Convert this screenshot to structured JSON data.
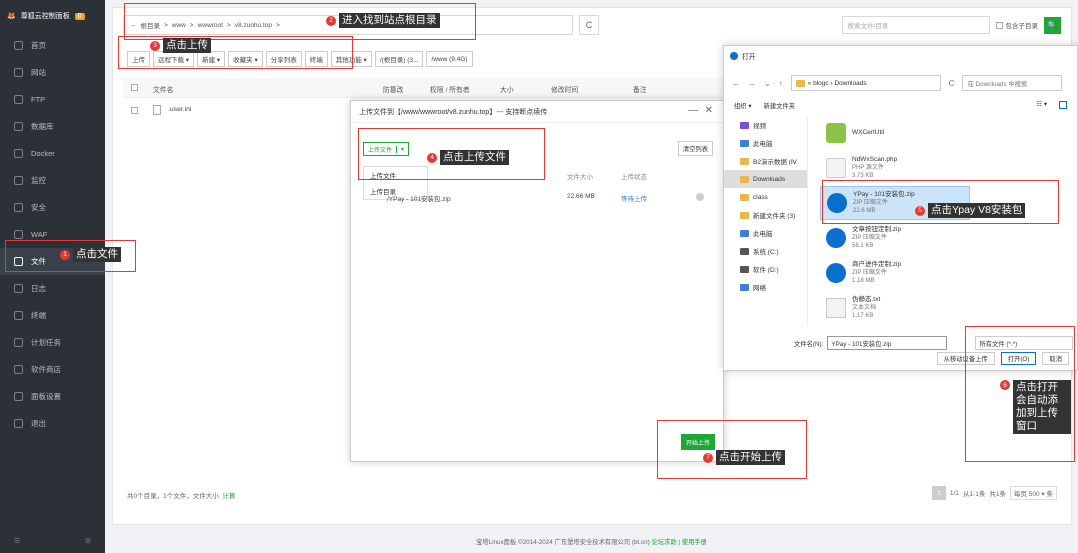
{
  "sidebar": {
    "brand": "尊狐云控制面板",
    "badge": "0",
    "items": [
      "首页",
      "网站",
      "FTP",
      "数据库",
      "Docker",
      "监控",
      "安全",
      "WAF",
      "文件",
      "日志",
      "终端",
      "计划任务",
      "软件商店",
      "面板设置",
      "退出"
    ],
    "foot_left": "☰",
    "foot_right": "⚙"
  },
  "path": {
    "back": "←",
    "parts": [
      "根目录",
      "www",
      "wwwroot",
      "v8.zunhu.top"
    ],
    "sep": ">"
  },
  "search": {
    "placeholder": "搜索文件/目录",
    "subdirs": "包含子目录",
    "btn": "🔍"
  },
  "toolbar": [
    "上传",
    "远程下载 ▾",
    "新建 ▾",
    "收藏夹 ▾",
    "分享列表",
    "终端",
    "其他功能 ▾",
    "/(根目录) (3...",
    "/www (9.4G)"
  ],
  "table": {
    "headers": [
      "文件名",
      "防篡改",
      "权限 / 所有者",
      "大小",
      "修改时间",
      "备注"
    ],
    "row": ".user.ini"
  },
  "footer": {
    "stats": "共0个目录，1个文件，文件大小:",
    "calc": "计算",
    "pager": [
      "1",
      "1/1",
      "从1-1条",
      "共1条",
      "每页 500 ▾ 条"
    ]
  },
  "copyright": {
    "text": "宝塔Linux面板 ©2014-2024 广东堡塔安全技术有限公司 (bt.cn)",
    "forum": "论坛求助",
    "sep": "|",
    "manual": "使用手册"
  },
  "upload": {
    "title": "上传文件到【/www/wwwroot/v8.zunhu.top】--- 支持断点续传",
    "min": "—",
    "close": "✕",
    "btn": "上传文件",
    "caret": "▾",
    "dd": [
      "上传文件",
      "上传目录"
    ],
    "clear": "清空列表",
    "cols": [
      "文件大小",
      "上传状态"
    ],
    "file": "/YPay - 101安装包.zip",
    "size": "22.66 MB",
    "status": "等待上传",
    "start": "开始上传"
  },
  "dialog": {
    "title": "打开",
    "address": "« blogc › Downloads",
    "search": "在 Downloads 中搜索",
    "cmds": [
      "组织 ▾",
      "新建文件夹"
    ],
    "nav": [
      {
        "n": "视频",
        "c": "#7b4fd6"
      },
      {
        "n": "此电脑",
        "c": "#3b7fd6"
      },
      {
        "n": "B2演示数据 (Ⅳ",
        "c": "#e8b84a"
      },
      {
        "n": "Downloads",
        "c": "#e8b84a"
      },
      {
        "n": "class",
        "c": "#e8b84a"
      },
      {
        "n": "新建文件夹 (3)",
        "c": "#e8b84a"
      },
      {
        "n": "此电脑",
        "c": "#3b7fd6"
      },
      {
        "n": "系统 (C:)",
        "c": "#555"
      },
      {
        "n": "软件 (D:)",
        "c": "#555"
      },
      {
        "n": "网络",
        "c": "#3b7fd6"
      }
    ],
    "files": [
      {
        "n": "WXCertUtil",
        "t": "",
        "s": "",
        "k": "cert"
      },
      {
        "n": "NdWxScan.php",
        "t": "PHP 源文件",
        "s": "3.73 KB",
        "k": "php"
      },
      {
        "n": "YPay - 101安装包.zip",
        "t": "ZIP 压缩文件",
        "s": "22.6 MB",
        "k": "zip"
      },
      {
        "n": "文章按钮定制.zip",
        "t": "ZIP 压缩文件",
        "s": "56.1 KB",
        "k": "zip"
      },
      {
        "n": "商户进件定制.zip",
        "t": "ZIP 压缩文件",
        "s": "1.18 MB",
        "k": "zip"
      },
      {
        "n": "伪静态.txt",
        "t": "文本文档",
        "s": "1.17 KB",
        "k": "txt"
      }
    ],
    "fn_label": "文件名(N):",
    "fn_value": "YPay - 101安装包.zip",
    "type": "所有文件 (*.*)",
    "btn_device": "从移动设备上传",
    "btn_open": "打开(O)",
    "btn_cancel": "取消"
  },
  "notes": [
    {
      "n": "1",
      "t": "点击文件"
    },
    {
      "n": "2",
      "t": "进入找到站点根目录"
    },
    {
      "n": "3",
      "t": "点击上传"
    },
    {
      "n": "4",
      "t": "点击上传文件"
    },
    {
      "n": "5",
      "t": "点击Ypay V8安装包"
    },
    {
      "n": "6",
      "t": "点击打开会自动添加到上传窗口"
    },
    {
      "n": "7",
      "t": "点击开始上传"
    }
  ],
  "colors": {
    "accent": "#20a53a",
    "annotation": "#e53935"
  }
}
